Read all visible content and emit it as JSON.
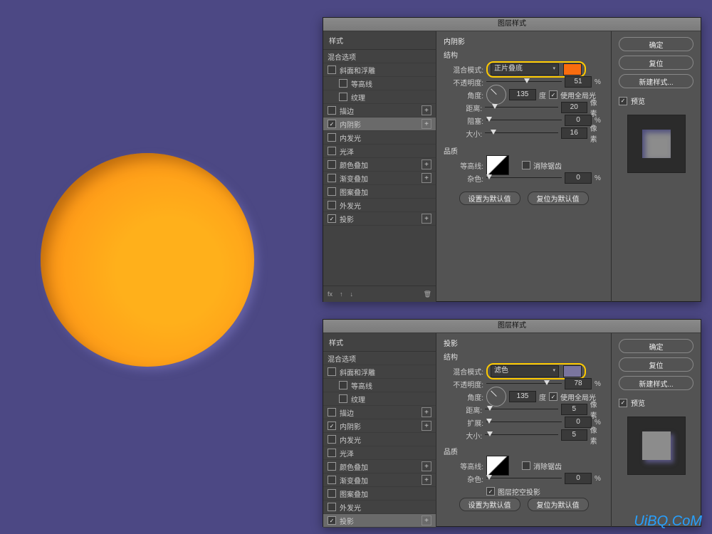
{
  "dialog_title": "图层样式",
  "styles_header": "样式",
  "blend_options_label": "混合选项",
  "effects": {
    "bevel": "斜面和浮雕",
    "contour": "等高线",
    "texture": "纹理",
    "stroke": "描边",
    "inner_shadow": "内阴影",
    "inner_glow": "内发光",
    "satin": "光泽",
    "color_overlay": "颜色叠加",
    "gradient_overlay": "渐变叠加",
    "pattern_overlay": "图案叠加",
    "outer_glow": "外发光",
    "drop_shadow": "投影"
  },
  "fx_label": "fx",
  "right": {
    "ok": "确定",
    "cancel": "复位",
    "new_style": "新建样式...",
    "preview_label": "预览"
  },
  "labels": {
    "structure": "结构",
    "blend_mode": "混合模式:",
    "opacity": "不透明度:",
    "angle": "角度:",
    "degree": "度",
    "global_light": "使用全局光",
    "distance": "距离:",
    "choke": "阻塞:",
    "spread": "扩展:",
    "size": "大小:",
    "pixels": "像素",
    "percent": "%",
    "quality": "品质",
    "contour_label": "等高线:",
    "antialias": "消除锯齿",
    "noise": "杂色:",
    "knockout": "图层挖空投影",
    "set_default": "设置为默认值",
    "reset_default": "复位为默认值"
  },
  "panel1": {
    "title": "内阴影",
    "blend_mode": "正片叠底",
    "swatch": "#f96c0f",
    "opacity": 51,
    "angle": 135,
    "distance": 20,
    "choke": 0,
    "size": 16,
    "noise": 0
  },
  "panel2": {
    "title": "投影",
    "blend_mode": "滤色",
    "swatch": "#7a759f",
    "opacity": 78,
    "angle": 135,
    "distance": 5,
    "spread": 0,
    "size": 5,
    "noise": 0
  },
  "watermark": "UiBQ.CoM"
}
